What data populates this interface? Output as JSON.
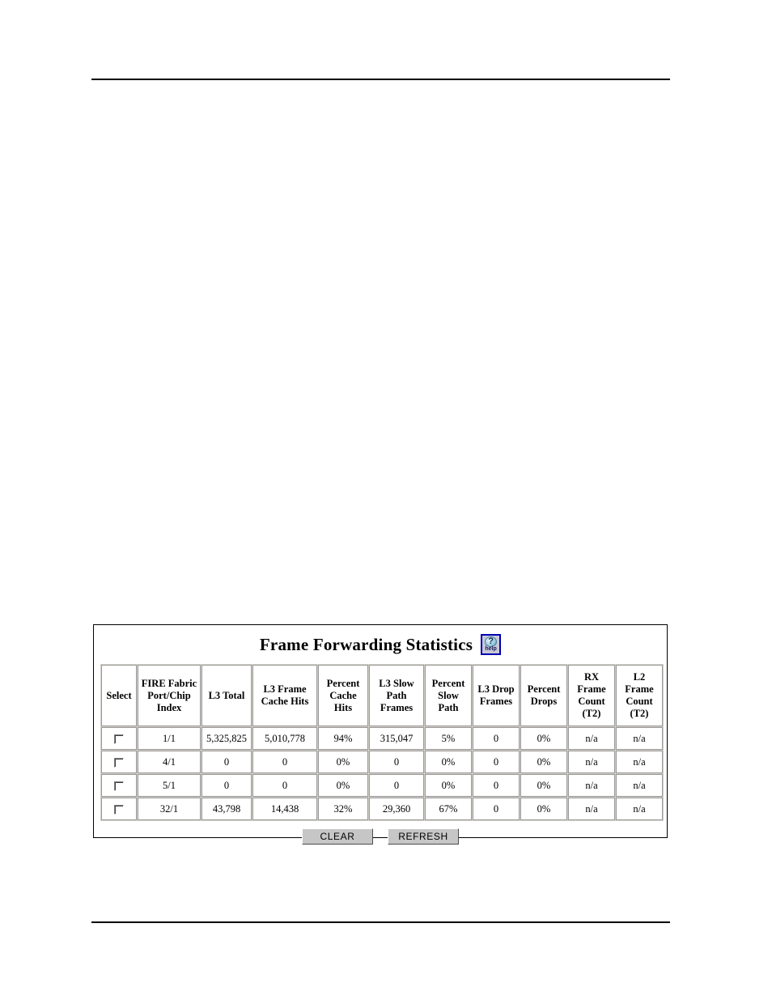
{
  "page": {
    "top_rule": true,
    "bottom_rule": true
  },
  "panel": {
    "title": "Frame Forwarding Statistics",
    "help_icon": {
      "name": "help-icon",
      "glyph": "?",
      "label": "help"
    }
  },
  "table": {
    "columns": [
      "Select",
      "FIRE Fabric Port/Chip Index",
      "L3 Total",
      "L3 Frame Cache Hits",
      "Percent Cache Hits",
      "L3 Slow Path Frames",
      "Percent Slow Path",
      "L3 Drop Frames",
      "Percent Drops",
      "RX Frame Count (T2)",
      "L2 Frame Count (T2)"
    ],
    "columns_lines": [
      [
        "Select"
      ],
      [
        "FIRE Fabric",
        "Port/Chip",
        "Index"
      ],
      [
        "L3 Total"
      ],
      [
        "L3 Frame",
        "Cache Hits"
      ],
      [
        "Percent",
        "Cache",
        "Hits"
      ],
      [
        "L3 Slow",
        "Path",
        "Frames"
      ],
      [
        "Percent",
        "Slow",
        "Path"
      ],
      [
        "L3 Drop",
        "Frames"
      ],
      [
        "Percent",
        "Drops"
      ],
      [
        "RX",
        "Frame",
        "Count",
        "(T2)"
      ],
      [
        "L2",
        "Frame",
        "Count",
        "(T2)"
      ]
    ],
    "rows": [
      {
        "selected": false,
        "index": "1/1",
        "l3_total": "5,325,825",
        "l3_frame_cache_hits": "5,010,778",
        "percent_cache_hits": "94%",
        "l3_slow_path_frames": "315,047",
        "percent_slow_path": "5%",
        "l3_drop_frames": "0",
        "percent_drops": "0%",
        "rx_frame_count_t2": "n/a",
        "l2_frame_count_t2": "n/a"
      },
      {
        "selected": false,
        "index": "4/1",
        "l3_total": "0",
        "l3_frame_cache_hits": "0",
        "percent_cache_hits": "0%",
        "l3_slow_path_frames": "0",
        "percent_slow_path": "0%",
        "l3_drop_frames": "0",
        "percent_drops": "0%",
        "rx_frame_count_t2": "n/a",
        "l2_frame_count_t2": "n/a"
      },
      {
        "selected": false,
        "index": "5/1",
        "l3_total": "0",
        "l3_frame_cache_hits": "0",
        "percent_cache_hits": "0%",
        "l3_slow_path_frames": "0",
        "percent_slow_path": "0%",
        "l3_drop_frames": "0",
        "percent_drops": "0%",
        "rx_frame_count_t2": "n/a",
        "l2_frame_count_t2": "n/a"
      },
      {
        "selected": false,
        "index": "32/1",
        "l3_total": "43,798",
        "l3_frame_cache_hits": "14,438",
        "percent_cache_hits": "32%",
        "l3_slow_path_frames": "29,360",
        "percent_slow_path": "67%",
        "l3_drop_frames": "0",
        "percent_drops": "0%",
        "rx_frame_count_t2": "n/a",
        "l2_frame_count_t2": "n/a"
      }
    ]
  },
  "buttons": {
    "clear": "CLEAR",
    "refresh": "REFRESH"
  },
  "colors": {
    "help_border": "#0000b4",
    "table_grid": "#9a9a9a",
    "button_face": "#c6c6c6",
    "page_rule": "#000000"
  }
}
